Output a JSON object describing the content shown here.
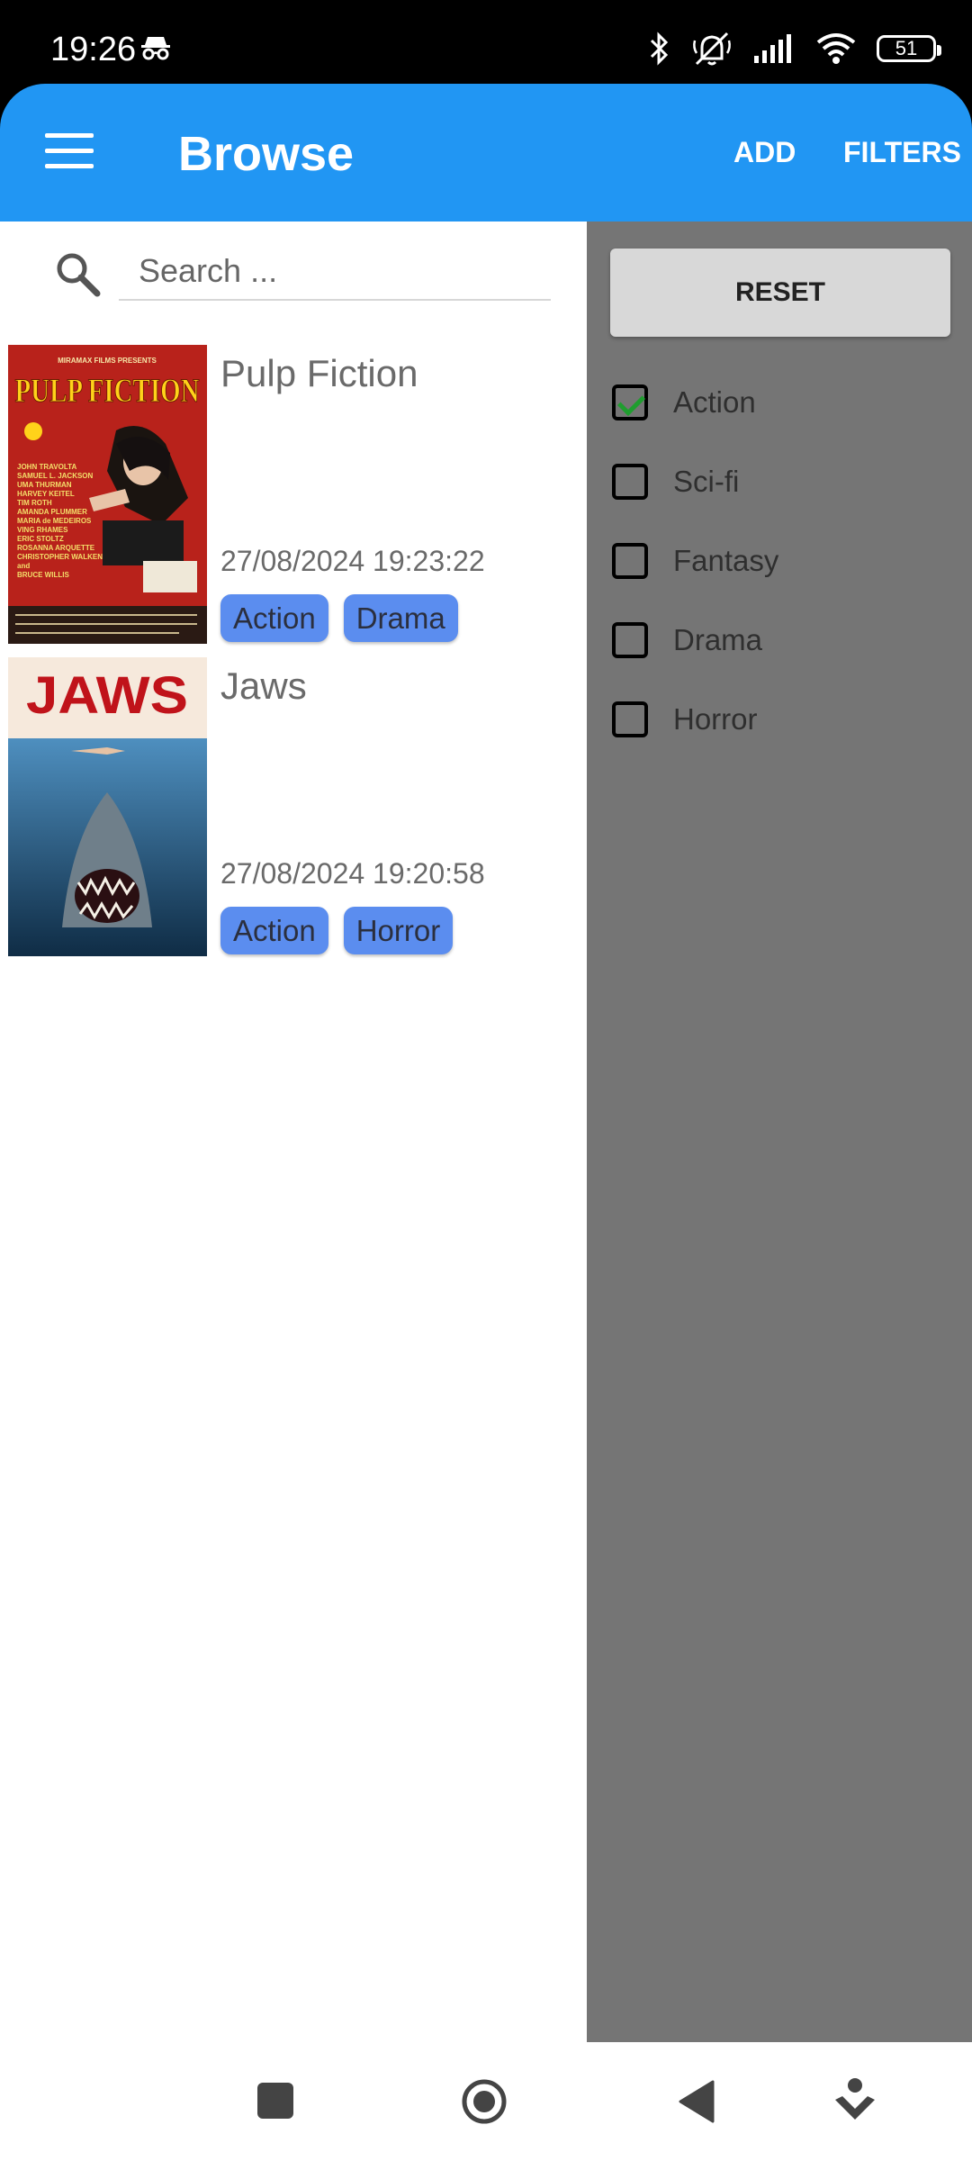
{
  "status_bar": {
    "time": "19:26",
    "battery": "51",
    "icons": [
      "incognito-icon",
      "bluetooth-icon",
      "silent-icon",
      "signal-icon",
      "wifi-icon",
      "battery-icon"
    ]
  },
  "app_bar": {
    "title": "Browse",
    "add_label": "ADD",
    "filters_label": "FILTERS",
    "color": "#2196F3"
  },
  "search": {
    "placeholder": "Search ..."
  },
  "movies": [
    {
      "title": "Pulp Fiction",
      "date": "27/08/2024 19:23:22",
      "tags": [
        "Action",
        "Drama"
      ],
      "poster": {
        "top_text": "MIRAMAX FILMS PRESENTS",
        "title": "PULP FICTION",
        "credits": [
          "JOHN TRAVOLTA",
          "SAMUEL L. JACKSON",
          "UMA THURMAN",
          "HARVEY KEITEL",
          "TIM ROTH",
          "AMANDA PLUMMER",
          "MARIA de MEDEIROS",
          "VING RHAMES",
          "ERIC STOLTZ",
          "ROSANNA ARQUETTE",
          "CHRISTOPHER WALKEN",
          "and",
          "BRUCE WILLIS"
        ]
      }
    },
    {
      "title": "Jaws",
      "date": "27/08/2024 19:20:58",
      "tags": [
        "Action",
        "Horror"
      ],
      "poster": {
        "title": "JAWS"
      }
    }
  ],
  "filters": {
    "reset_label": "RESET",
    "options": [
      {
        "label": "Action",
        "checked": true
      },
      {
        "label": "Sci-fi",
        "checked": false
      },
      {
        "label": "Fantasy",
        "checked": false
      },
      {
        "label": "Drama",
        "checked": false
      },
      {
        "label": "Horror",
        "checked": false
      }
    ]
  },
  "nav_bar": {
    "icons": [
      "recent-apps-icon",
      "home-icon",
      "back-icon",
      "assistant-icon"
    ]
  }
}
